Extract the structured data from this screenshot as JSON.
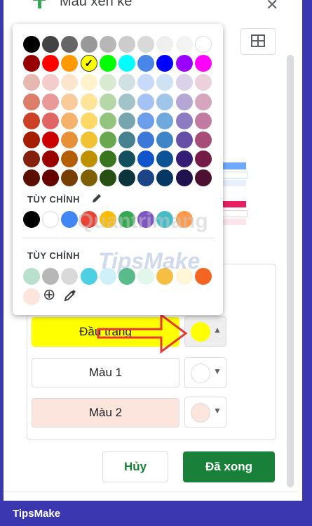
{
  "header": {
    "title": "Màu xen kẽ",
    "close": "✕"
  },
  "palette": {
    "custom_label_1": "TÙY CHỈNH",
    "custom_label_2": "TÙY CHỈNH",
    "selected_color": "#ffff00",
    "check": "✓",
    "grid": [
      [
        "#000000",
        "#434343",
        "#666666",
        "#999999",
        "#b7b7b7",
        "#cccccc",
        "#d9d9d9",
        "#efefef",
        "#f3f3f3",
        "#ffffff"
      ],
      [
        "#980000",
        "#ff0000",
        "#ff9900",
        "#ffff00",
        "#00ff00",
        "#00ffff",
        "#4a86e8",
        "#0000ff",
        "#9900ff",
        "#ff00ff"
      ],
      [
        "#e6b8af",
        "#f4cccc",
        "#fce5cd",
        "#fff2cc",
        "#d9ead3",
        "#d0e0e3",
        "#c9daf8",
        "#cfe2f3",
        "#d9d2e9",
        "#ead1dc"
      ],
      [
        "#dd7e6b",
        "#ea9999",
        "#f9cb9c",
        "#ffe599",
        "#b6d7a8",
        "#a2c4c9",
        "#a4c2f4",
        "#9fc5e8",
        "#b4a7d6",
        "#d5a6bd"
      ],
      [
        "#cc4125",
        "#e06666",
        "#f6b26b",
        "#ffd966",
        "#93c47d",
        "#76a5af",
        "#6d9eeb",
        "#6fa8dc",
        "#8e7cc3",
        "#c27ba0"
      ],
      [
        "#a61c00",
        "#cc0000",
        "#e69138",
        "#f1c232",
        "#6aa84f",
        "#45818e",
        "#3c78d8",
        "#3d85c6",
        "#674ea7",
        "#a64d79"
      ],
      [
        "#85200c",
        "#990000",
        "#b45f06",
        "#bf9000",
        "#38761d",
        "#134f5c",
        "#1155cc",
        "#0b5394",
        "#351c75",
        "#741b47"
      ],
      [
        "#5b0f00",
        "#660000",
        "#783f04",
        "#7f6000",
        "#274e13",
        "#0c343d",
        "#1c4587",
        "#073763",
        "#20124d",
        "#4c1130"
      ]
    ],
    "theme_row": [
      "#000000",
      "#ffffff",
      "#4285f4",
      "#ea4335",
      "#fbbc04",
      "#34a853",
      "#7e57c2",
      "#46bdc6",
      "#ff9a4d"
    ],
    "custom_row_1": [
      "#b7e1cd",
      "#b7b7b7",
      "#d9d9d9",
      "#4dd0e1",
      "#d0f0f9",
      "#57bb8a",
      "#e0f7ea",
      "#f6bf44",
      "#fff5d7",
      "#f46524"
    ],
    "custom_row_2": [
      "#fce5dd"
    ],
    "add_icon": "⊕",
    "eyedropper_icon": "eyedropper"
  },
  "rows": [
    {
      "label": "Đầu trang",
      "fill": "#ffff00",
      "swatch": "#ffff00"
    },
    {
      "label": "Màu 1",
      "fill": "#ffffff",
      "swatch": "#ffffff"
    },
    {
      "label": "Màu 2",
      "fill": "#fce5dd",
      "swatch": "#fce5dd"
    }
  ],
  "actions": {
    "cancel": "Hủy",
    "done": "Đã xong"
  },
  "footer": {
    "brand": "TipsMake"
  },
  "watermarks": {
    "a": "Quantrimang",
    "b": "TipsMake"
  },
  "colors": {
    "accent": "#188038",
    "footer_bg": "#3b37b0",
    "arrow": "#e53935"
  }
}
